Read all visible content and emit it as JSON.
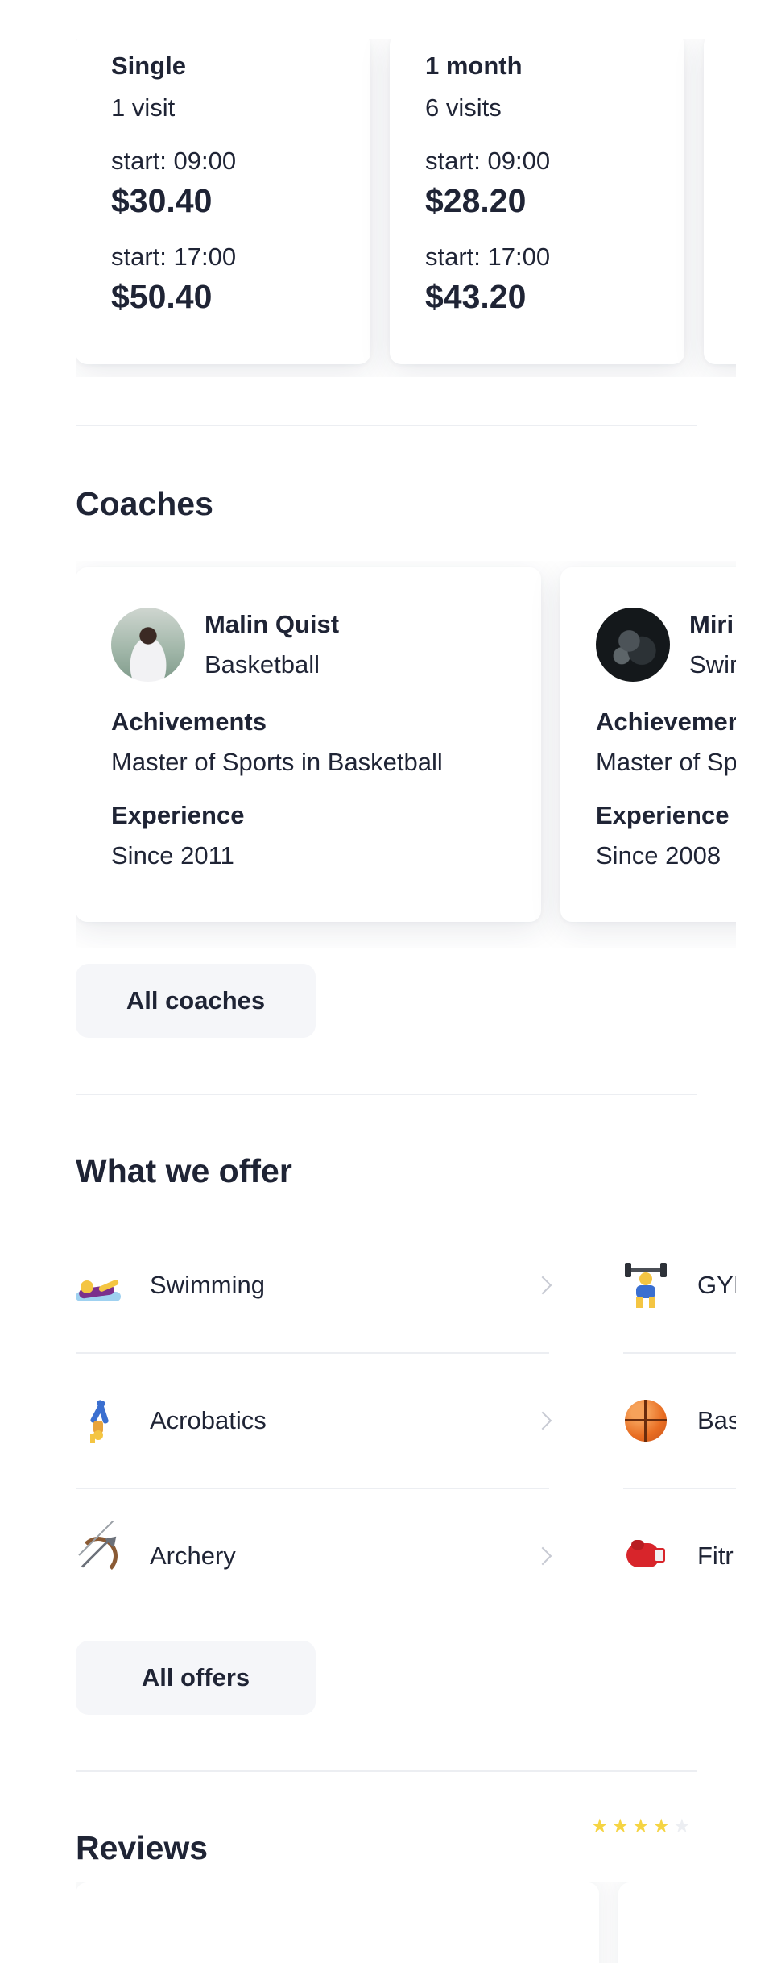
{
  "pricing": [
    {
      "title": "Single",
      "visits": "1 visit",
      "start1": "start: 09:00",
      "price1": "$30.40",
      "start2": "start: 17:00",
      "price2": "$50.40"
    },
    {
      "title": "1 month",
      "visits": "6 visits",
      "start1": "start: 09:00",
      "price1": "$28.20",
      "start2": "start: 17:00",
      "price2": "$43.20"
    }
  ],
  "coaches": {
    "title": "Coaches",
    "button": "All coaches",
    "items": [
      {
        "name": "Malin Quist",
        "sport": "Basketball",
        "achievements_label": "Achivements",
        "achievements": "Master of Sports in Basketball",
        "experience_label": "Experience",
        "experience": "Since 2011"
      },
      {
        "name": "Miri",
        "sport": "Swir",
        "achievements_label": "Achievement",
        "achievements": "Master of Sp",
        "experience_label": "Experience",
        "experience": "Since 2008"
      }
    ]
  },
  "offers": {
    "title": "What we offer",
    "button": "All offers",
    "left": [
      {
        "label": "Swimming",
        "icon": "swimming-icon"
      },
      {
        "label": "Acrobatics",
        "icon": "acrobatics-icon"
      },
      {
        "label": "Archery",
        "icon": "archery-icon"
      }
    ],
    "right": [
      {
        "label": "GYI",
        "icon": "weightlifting-icon"
      },
      {
        "label": "Bas",
        "icon": "basketball-icon"
      },
      {
        "label": "Fitr",
        "icon": "boxing-glove-icon"
      }
    ]
  },
  "reviews": {
    "title": "Reviews",
    "rating": 4,
    "max_rating": 5,
    "star_color": "#f5d443"
  }
}
